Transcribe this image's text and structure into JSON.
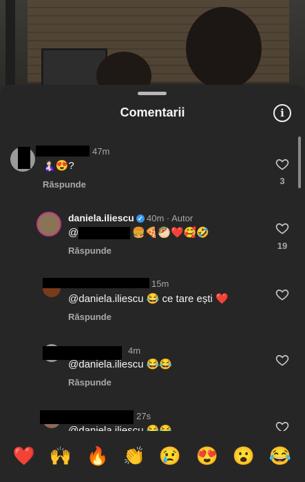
{
  "sheet": {
    "title": "Comentarii",
    "info_icon": "info-icon"
  },
  "comments": [
    {
      "time": "47m",
      "text": "🤱🏻😍?",
      "reply": "Răspunde",
      "likes": "3"
    },
    {
      "username": "daniela.iliescu",
      "meta": "40m · Autor",
      "text_prefix": "@d",
      "text_emojis": "🍔🍕🥙❤️🥰🤣",
      "reply": "Răspunde",
      "likes": "19"
    },
    {
      "time": "15m",
      "text": "@daniela.iliescu 😂 ce tare ești ❤️",
      "reply": "Răspunde"
    },
    {
      "time": "4m",
      "text": "@daniela.iliescu 😂😂",
      "reply": "Răspunde"
    },
    {
      "time": "27s",
      "text": "@daniela.iliescu 😂😂"
    }
  ],
  "emoji_bar": [
    "❤️",
    "🙌",
    "🔥",
    "👏",
    "😢",
    "😍",
    "😮",
    "😂"
  ],
  "colors": {
    "sheet_bg": "#262626",
    "verified": "#3897f0",
    "secondary_text": "#a8a8a8"
  }
}
